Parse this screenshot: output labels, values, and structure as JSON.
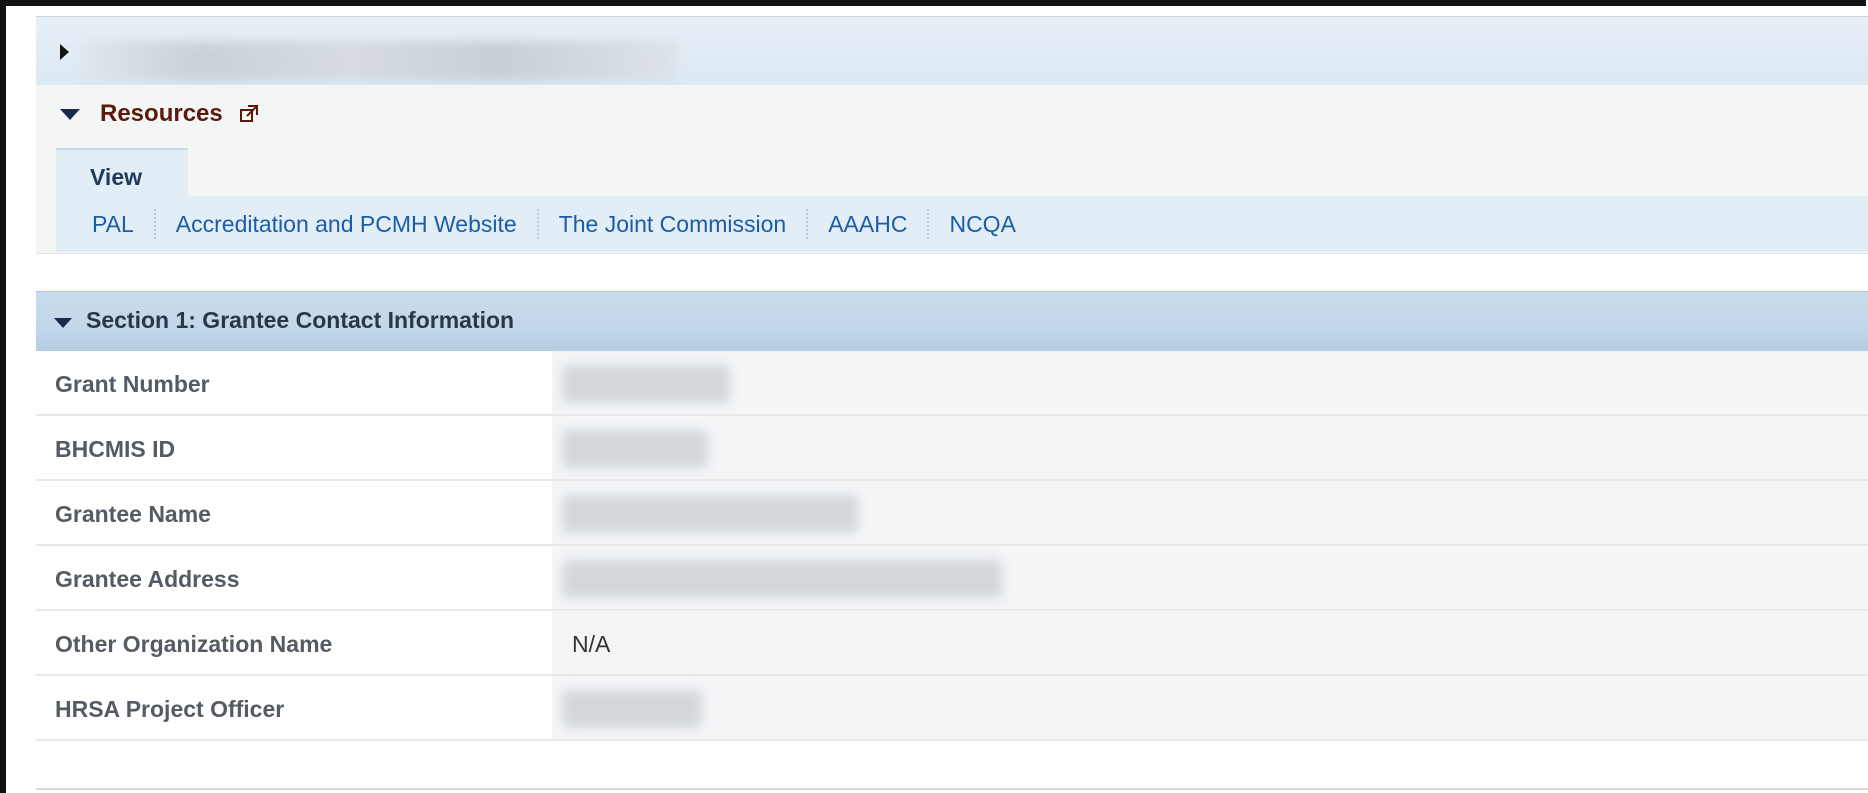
{
  "resources": {
    "title": "Resources",
    "tab_label": "View",
    "links": [
      "PAL",
      "Accreditation and PCMH Website",
      "The Joint Commission",
      "AAAHC",
      "NCQA"
    ]
  },
  "section1": {
    "title": "Section 1: Grantee Contact Information",
    "rows": [
      {
        "label": "Grant Number",
        "value": ""
      },
      {
        "label": "BHCMIS ID",
        "value": ""
      },
      {
        "label": "Grantee Name",
        "value": ""
      },
      {
        "label": "Grantee Address",
        "value": ""
      },
      {
        "label": "Other Organization Name",
        "value": "N/A"
      },
      {
        "label": "HRSA Project Officer",
        "value": ""
      }
    ]
  },
  "colors": {
    "link": "#1a5da8",
    "resources_title": "#5a1a0c",
    "section_header_bg": "#c2d7ea"
  },
  "icons": {
    "expand": "chevron-right-icon",
    "collapse": "chevron-down-icon",
    "external": "external-link-icon"
  }
}
